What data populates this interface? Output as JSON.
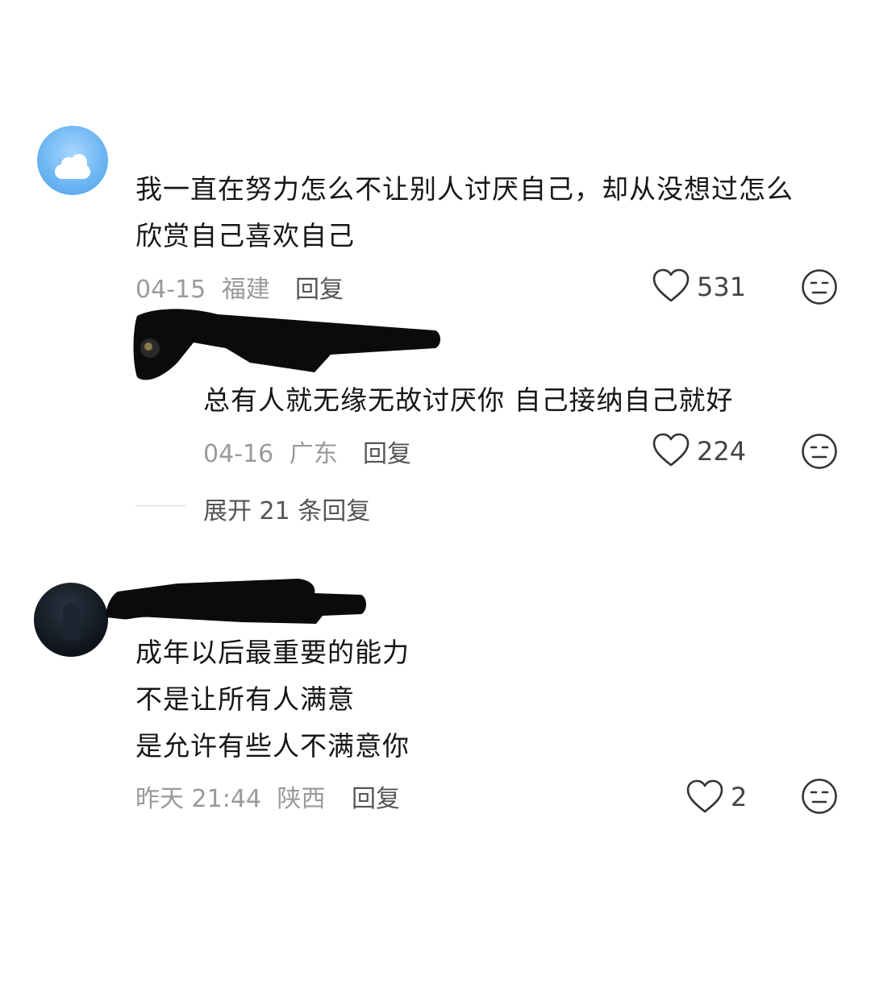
{
  "comments": [
    {
      "text_lines": [
        "我一直在努力怎么不让别人讨厌自己，却从没想过怎么",
        "欣赏自己喜欢自己"
      ],
      "date": "04-15",
      "location": "福建",
      "reply_label": "回复",
      "likes": "531",
      "like_icon": "heart-outline-icon",
      "dislike_icon": "neutral-face-icon",
      "replies": [
        {
          "text_lines": [
            "总有人就无缘无故讨厌你 自己接纳自己就好"
          ],
          "date": "04-16",
          "location": "广东",
          "reply_label": "回复",
          "likes": "224"
        }
      ],
      "expand_label": "展开 21 条回复"
    },
    {
      "text_lines": [
        "成年以后最重要的能力",
        "不是让所有人满意",
        "是允许有些人不满意你"
      ],
      "date": "昨天 21:44",
      "location": "陕西",
      "reply_label": "回复",
      "likes": "2"
    }
  ]
}
